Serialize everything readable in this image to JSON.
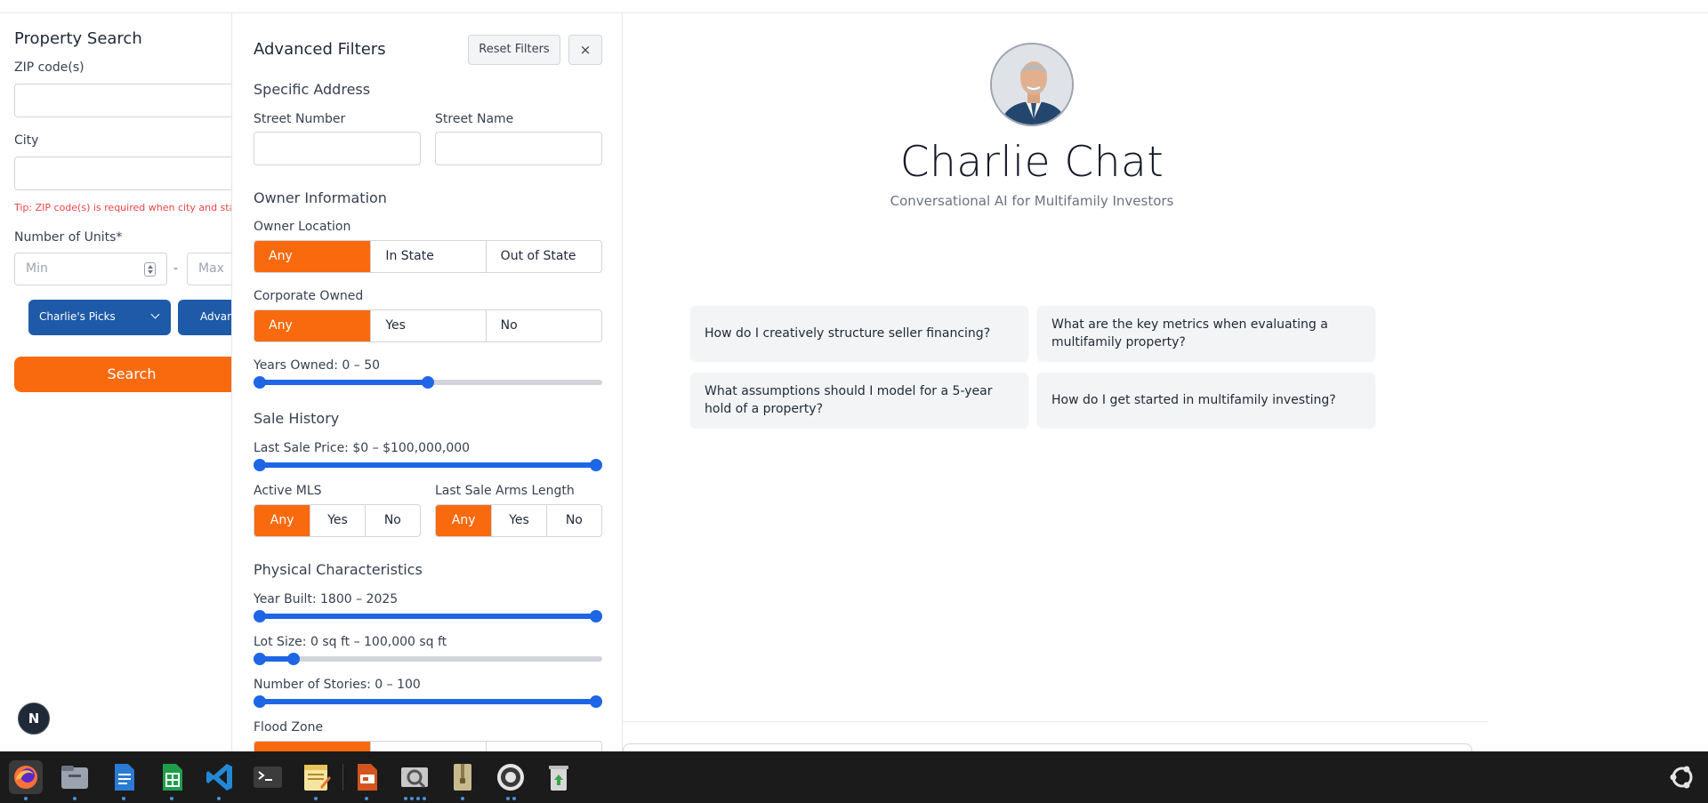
{
  "sidebar": {
    "title": "Property Search",
    "zip_label": "ZIP code(s)",
    "city_label": "City",
    "tip": "Tip: ZIP code(s) is required when city and state...",
    "units_label": "Number of Units*",
    "units_min_placeholder": "Min",
    "units_dash": "-",
    "units_max_placeholder": "Max",
    "picks_button": "Charlie's Picks",
    "advanced_button": "Advan",
    "search_button": "Search"
  },
  "filters": {
    "title": "Advanced Filters",
    "reset_button": "Reset Filters",
    "close_button": "×",
    "specific_address": {
      "heading": "Specific Address",
      "street_number_label": "Street Number",
      "street_name_label": "Street Name"
    },
    "owner": {
      "heading": "Owner Information",
      "location_label": "Owner Location",
      "location_options": [
        "Any",
        "In State",
        "Out of State"
      ],
      "location_selected": "Any",
      "corporate_label": "Corporate Owned",
      "corporate_options": [
        "Any",
        "Yes",
        "No"
      ],
      "corporate_selected": "Any",
      "years_owned_label": "Years Owned: 0 – 50",
      "years_owned_range": [
        0,
        50
      ],
      "years_owned_display": [
        0,
        0.5
      ]
    },
    "sale_history": {
      "heading": "Sale History",
      "last_sale_price_label": "Last Sale Price: $0 – $100,000,000",
      "last_sale_price_display": [
        0,
        1
      ],
      "active_mls_label": "Active MLS",
      "active_mls_options": [
        "Any",
        "Yes",
        "No"
      ],
      "active_mls_selected": "Any",
      "arms_length_label": "Last Sale Arms Length",
      "arms_length_options": [
        "Any",
        "Yes",
        "No"
      ],
      "arms_length_selected": "Any"
    },
    "physical": {
      "heading": "Physical Characteristics",
      "year_built_label": "Year Built: 1800 – 2025",
      "year_built_range": [
        1800,
        2025
      ],
      "year_built_display": [
        0,
        1
      ],
      "lot_size_label": "Lot Size: 0 sq ft – 100,000 sq ft",
      "lot_size_display": [
        0,
        0.1
      ],
      "stories_label": "Number of Stories: 0 – 100",
      "stories_display": [
        0,
        1
      ],
      "flood_zone_label": "Flood Zone"
    }
  },
  "chat": {
    "title": "Charlie Chat",
    "subtitle": "Conversational AI for Multifamily Investors",
    "suggestions": [
      "How do I creatively structure seller financing?",
      "What are the key metrics when evaluating a multifamily property?",
      "What assumptions should I model for a 5-year hold of a property?",
      "How do I get started in multifamily investing?"
    ]
  },
  "nextjs_badge": "N",
  "colors": {
    "accent_orange": "#f96a0e",
    "brand_blue": "#1e5aa8",
    "slider_blue": "#1e66e6"
  },
  "taskbar": {
    "apps": [
      "firefox-icon",
      "files-icon",
      "writer-icon",
      "calc-icon",
      "vscode-icon",
      "terminal-icon",
      "text-editor-icon",
      "impress-icon",
      "image-viewer-icon",
      "archive-icon",
      "settings-icon",
      "trash-icon"
    ],
    "right": "ubuntu-logo-icon"
  }
}
